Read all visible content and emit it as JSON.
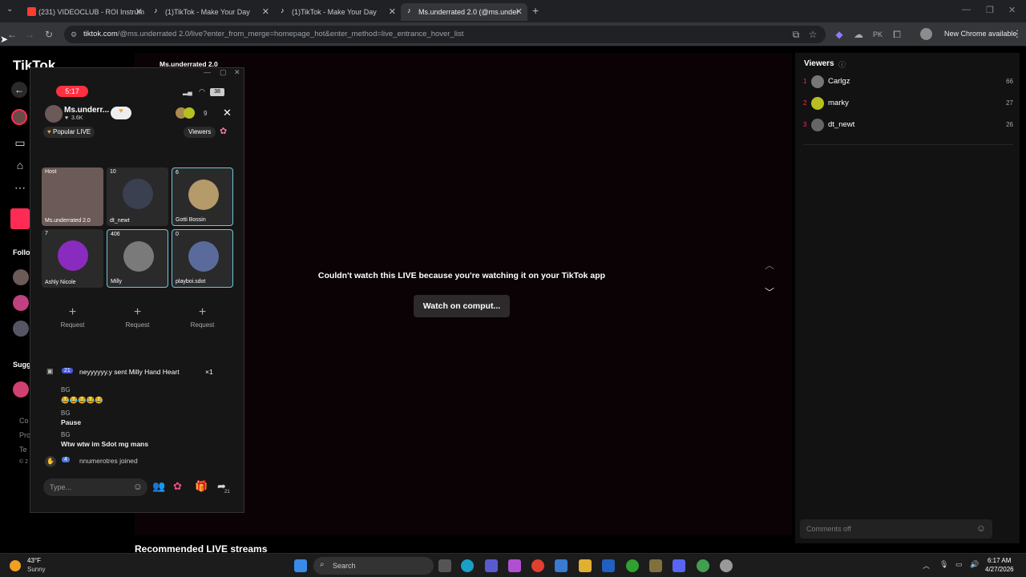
{
  "browser": {
    "tabs": [
      {
        "title": "(231) VIDEOCLUB - ROI Instrum",
        "fav_color": "#ff3b30"
      },
      {
        "title": "(1)TikTok - Make Your Day",
        "fav_color": "#ffffff"
      },
      {
        "title": "(1)TikTok - Make Your Day",
        "fav_color": "#ffffff"
      },
      {
        "title": "Ms.underrated 2.0 (@ms.under",
        "fav_color": "#ffffff"
      }
    ],
    "url_host": "tiktok.com",
    "url_path": "/@ms.underrated 2.0/live?enter_from_merge=homepage_hot&enter_method=live_entrance_hover_list",
    "new_chrome_label": "New Chrome available"
  },
  "tiktok": {
    "logo_text": "TikTok",
    "host_name_top": "Ms.underrated 2.0",
    "nav_partial": {
      "following": "Follo",
      "suggested": "Sugg",
      "footer1": "Co",
      "footer2": "Pro",
      "footer3": "Te",
      "footer4": "© 2"
    },
    "error_message": "Couldn't watch this LIVE because you're watching it on your TikTok app",
    "watch_button": "Watch on comput...",
    "recommended_heading": "Recommended LIVE streams",
    "viewers_panel": {
      "title": "Viewers",
      "list": [
        {
          "rank": "1",
          "name": "Carlgz",
          "score": "66"
        },
        {
          "rank": "2",
          "name": "marky",
          "score": "27"
        },
        {
          "rank": "3",
          "name": "dt_newt",
          "score": "26"
        }
      ],
      "comments_placeholder": "Comments off"
    }
  },
  "popup": {
    "clock": "5:17",
    "battery": "38",
    "host_name": "Ms.underr...",
    "likes": "3.6K",
    "popular_live": "Popular LIVE",
    "viewer_count": "9",
    "viewers_button": "Viewers",
    "tiles": [
      {
        "badge": "Host",
        "name": "Ms.underrated 2.0",
        "color": "#6b5a58"
      },
      {
        "badge": "10",
        "name": "dt_newt",
        "color": "#3a4050"
      },
      {
        "badge": "6",
        "name": "Gotti Bossin",
        "color": "#b59a6a"
      },
      {
        "badge": "7",
        "name": "Ashly Nicole",
        "color": "#8a2bbf"
      },
      {
        "badge": "406",
        "name": "Milly",
        "color": "#7a7a7a"
      },
      {
        "badge": "0",
        "name": "playboi.sdot",
        "color": "#5a6a9a"
      }
    ],
    "request_label": "Request",
    "chat": {
      "gift_line_level": "21",
      "gift_line": "neyyyyyy.y sent Milly Hand Heart",
      "gift_count": "×1",
      "messages": [
        {
          "user": "BG",
          "text": "😂😂😂😂😂"
        },
        {
          "user": "BG",
          "text": "Pause"
        },
        {
          "user": "BG",
          "text": "Wtw wtw im Sdot mg mans"
        }
      ],
      "join_level": "4",
      "join_line": "nnumerotres joined"
    },
    "input_placeholder": "Type...",
    "share_count": "21"
  },
  "taskbar": {
    "weather_temp": "43°F",
    "weather_desc": "Sunny",
    "search_label": "Search",
    "time": "6:17 AM",
    "date": "4/27/2026"
  }
}
